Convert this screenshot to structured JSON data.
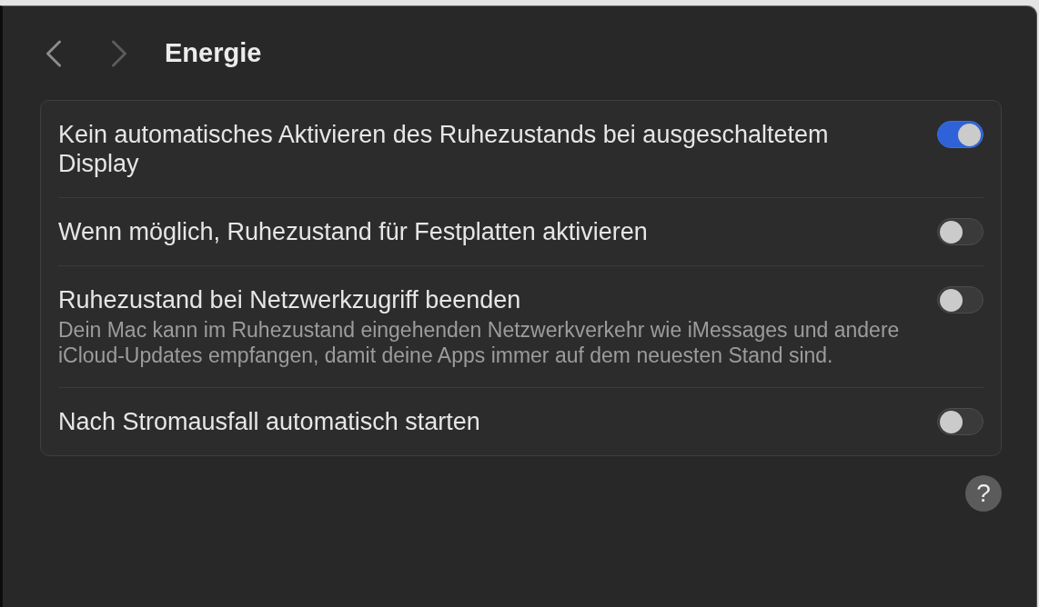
{
  "window": {
    "title": "Energie"
  },
  "navigation": [
    {
      "kind": "back",
      "disabled": false
    },
    {
      "kind": "forward",
      "disabled": true
    }
  ],
  "settings": [
    {
      "label": "Kein automatisches Aktivieren des Ruhezustands bei ausgeschaltetem Display",
      "on": true
    },
    {
      "label": "Wenn möglich, Ruhezustand für Festplatten aktivieren",
      "on": false
    },
    {
      "label": "Ruhezustand bei Netzwerkzugriff beenden",
      "description": "Dein Mac kann im Ruhezustand eingehenden Netzwerkverkehr wie iMessages und andere iCloud-Updates empfangen, damit deine Apps immer auf dem neuesten Stand sind.",
      "on": false
    },
    {
      "label": "Nach Stromausfall automatisch starten",
      "on": false
    }
  ],
  "help_button": {
    "label": "?"
  }
}
